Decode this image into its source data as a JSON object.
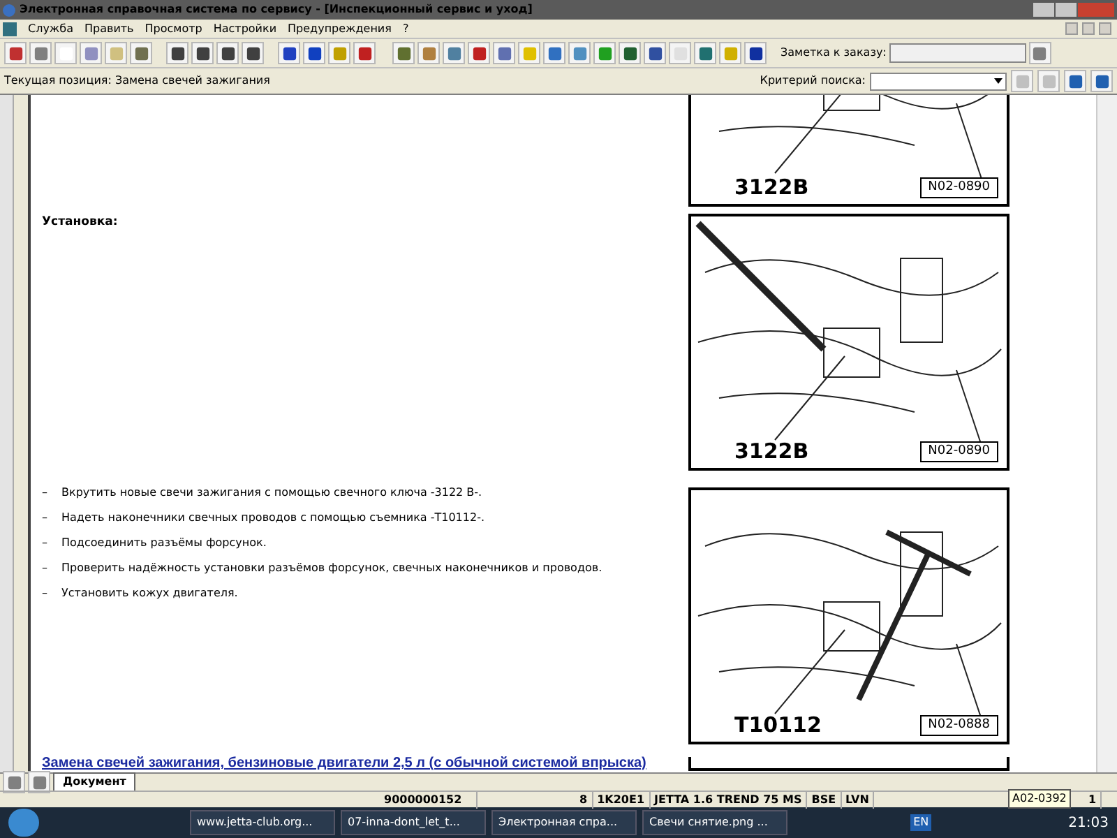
{
  "window": {
    "title": "Электронная справочная система по сервису - [Инспекционный сервис и уход]"
  },
  "menu": [
    "Служба",
    "Править",
    "Просмотр",
    "Настройки",
    "Предупреждения",
    "?"
  ],
  "order_note": {
    "label": "Заметка к заказу:"
  },
  "position": {
    "label": "Текущая позиция: Замена свечей зажигания"
  },
  "search": {
    "label": "Критерий поиска:"
  },
  "document": {
    "section_heading": "Установка:",
    "bullet": "–",
    "steps": [
      "Вкрутить новые свечи зажигания с помощью свечного ключа -3122 B-.",
      "Надеть наконечники свечных проводов с помощью съемника -T10112-.",
      "Подсоединить разъёмы форсунок.",
      "Проверить надёжность установки разъёмов форсунок, свечных наконечников и проводов.",
      "Установить кожух двигателя."
    ],
    "next_heading": "Замена свечей зажигания, бензиновые двигатели 2,5 л (с обычной системой впрыска)",
    "figures": [
      {
        "kind": "clipped",
        "tool": "3122B",
        "code": "N02-0890"
      },
      {
        "kind": "ratchet",
        "tool": "3122B",
        "code": "N02-0890"
      },
      {
        "kind": "puller",
        "tool": "T10112",
        "code": "N02-0888"
      },
      {
        "kind": "empty"
      }
    ]
  },
  "tabs": [
    {
      "label": "Документ",
      "selected": true
    }
  ],
  "status_bar": {
    "cells": [
      "9000000152",
      "8",
      "1K20E1",
      "JETTA 1.6 TREND 75 MS",
      "BSE",
      "LVN",
      "1"
    ],
    "tooltip": "A02-0392"
  },
  "taskbar": {
    "items": [
      {
        "label": "www.jetta-club.org...",
        "selected": false
      },
      {
        "label": "07-inna-dont_let_t...",
        "selected": false
      },
      {
        "label": "Электронная спра...",
        "selected": false
      },
      {
        "label": "Свечи снятие.png ...",
        "selected": false
      }
    ],
    "language": "EN",
    "clock": "21:03"
  }
}
